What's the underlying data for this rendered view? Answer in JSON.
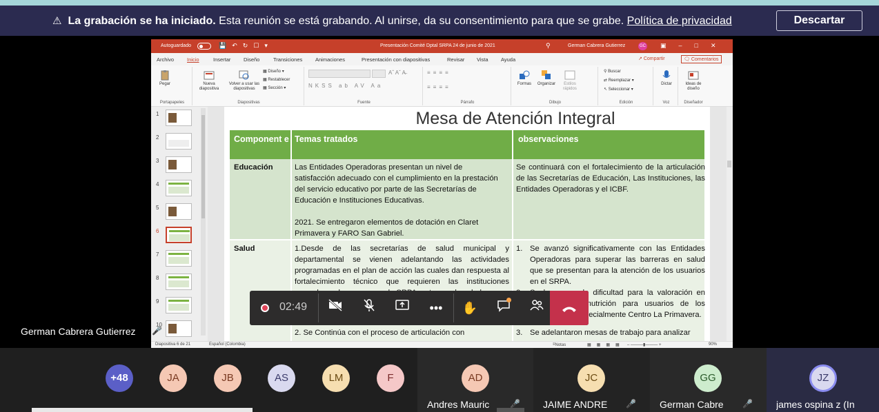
{
  "banner": {
    "bold": "La grabación se ha iniciado.",
    "text": " Esta reunión se está grabando. Al unirse, da su consentimiento para que se grabe. ",
    "link": "Política de privacidad",
    "dismiss": "Descartar"
  },
  "ppt": {
    "autosave": "Autoguardado",
    "doc_title": "Presentación Comité Dptal SRPA 24 de junio de 2021",
    "user": "German Cabrera Gutierrez",
    "user_initials": "GC",
    "menu": [
      "Archivo",
      "Inicio",
      "Insertar",
      "Diseño",
      "Transiciones",
      "Animaciones",
      "Presentación con diapositivas",
      "Revisar",
      "Vista",
      "Ayuda"
    ],
    "share": "Compartir",
    "comments": "Comentarios",
    "ribbon": {
      "paste": "Pegar",
      "clipboard_group": "Portapapeles",
      "new_slide": "Nueva diapositiva",
      "reuse_slides": "Volver a usar las diapositivas",
      "layout": "Diseño",
      "reset": "Restablecer",
      "section": "Sección",
      "slides_group": "Diapositivas",
      "font_group": "Fuente",
      "paragraph_group": "Párrafo",
      "shapes": "Formas",
      "arrange": "Organizar",
      "quick_styles": "Estilos rápidos",
      "drawing_group": "Dibujo",
      "find": "Buscar",
      "replace": "Reemplazar",
      "select": "Seleccionar",
      "editing_group": "Edición",
      "dictate": "Dictar",
      "voice_group": "Voz",
      "design_ideas": "Ideas de diseño",
      "designer_group": "Diseñador"
    },
    "thumbs": [
      "1",
      "2",
      "3",
      "4",
      "5",
      "6",
      "7",
      "8",
      "9",
      "10"
    ],
    "status_slide": "Diapositiva 6 de 21",
    "status_lang": "Español (Colombia)",
    "status_notes": "Notas",
    "status_zoom": "90%"
  },
  "slide": {
    "title": "Mesa de Atención Integral",
    "headers": [
      "Component e",
      "Temas tratados",
      "observaciones"
    ],
    "rows": [
      {
        "component": "Educación",
        "topics": "Las Entidades Operadoras presentan un nivel de satisfacción adecuado con el cumplimiento en la prestación del servicio educativo por parte de las Secretarías de Educación e Instituciones Educativas.",
        "topics2": "2021. Se entregaron elementos de dotación en Claret Primavera y FARO San Gabriel.",
        "obs": "Se continuará con el fortalecimiento de la articulación de las Secretarías de Educación, Las Instituciones, las Entidades Operadoras y el ICBF."
      },
      {
        "component": "Salud",
        "topics": "1.Desde de las secretarías de salud municipal y departamental se vienen adelantando las actividades programadas en el plan de acción las cuales dan respuesta al fortalecimiento técnico que requieren las instituciones operadoras de programas de SRPA en temas de salud.",
        "topics_next": "2. Se Continúa con el proceso de articulación con",
        "obs1_num": "1.",
        "obs1": "Se avanzó significativamente con las Entidades Operadoras para superar las barreras en salud que se presentan para la atención de los usuarios en el SRPA.",
        "obs2_num": "2.",
        "obs2": "Se ha generado dificultad para la valoración en odontología y nutrición para usuarios de los programas – Especialmente Centro La Primavera.",
        "obs3_num": "3.",
        "obs3": "Se adelantaron mesas de trabajo para analizar"
      }
    ]
  },
  "speaker": {
    "name": "German Cabrera Gutierrez"
  },
  "controls": {
    "timer": "02:49"
  },
  "participants": {
    "overflow": "+48",
    "small": [
      {
        "initials": "JA",
        "bg": "#f5c8b4",
        "fg": "#7a3a22"
      },
      {
        "initials": "JB",
        "bg": "#f5c8b4",
        "fg": "#7a3a22"
      },
      {
        "initials": "AS",
        "bg": "#d9d9ef",
        "fg": "#3a3a6a"
      },
      {
        "initials": "LM",
        "bg": "#f6deb0",
        "fg": "#6a4a12"
      },
      {
        "initials": "F",
        "bg": "#f5c8c8",
        "fg": "#7a2a2a"
      }
    ],
    "tiles": [
      {
        "initials": "AD",
        "name": "Andres Mauric",
        "bg": "#f5c8b4",
        "fg": "#7a3a22"
      },
      {
        "initials": "JC",
        "name": "JAIME ANDRE",
        "bg": "#f6deb0",
        "fg": "#6a4a12"
      },
      {
        "initials": "GG",
        "name": "German Cabre",
        "bg": "#cdeccd",
        "fg": "#2a5a2a"
      },
      {
        "initials": "JZ",
        "name": "james ospina z (In",
        "bg": "#d9d9ef",
        "fg": "#3a3a6a"
      }
    ]
  }
}
